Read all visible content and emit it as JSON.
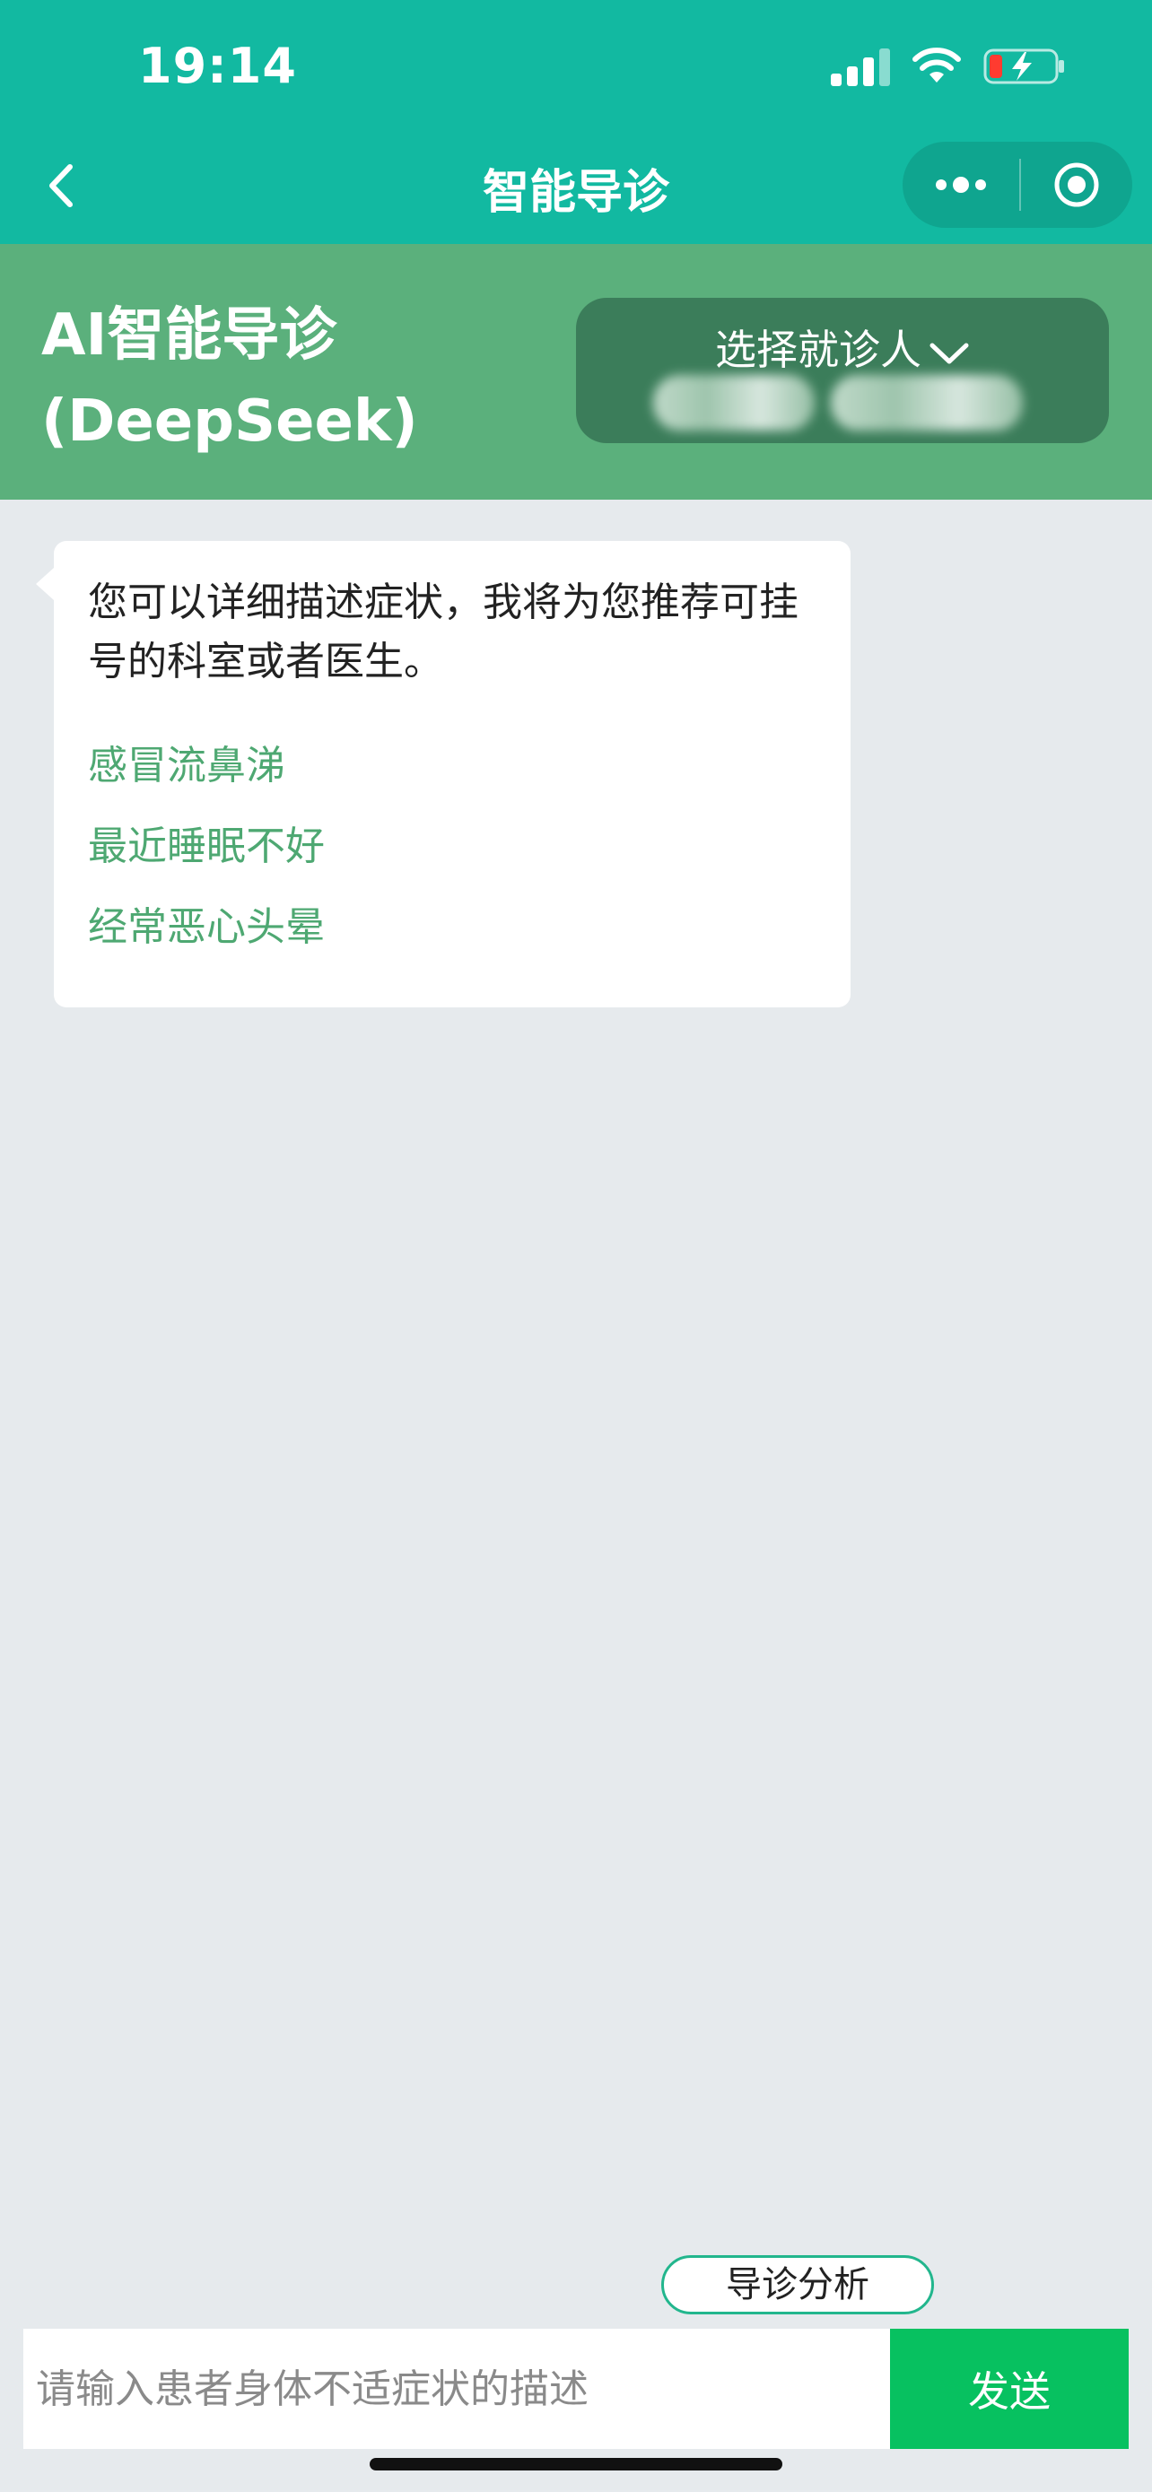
{
  "status_bar": {
    "time": "19:14"
  },
  "nav": {
    "title": "智能导诊"
  },
  "hero": {
    "title_line1": "AI智能导诊",
    "title_line2": "(DeepSeek)",
    "patient_select_label": "选择就诊人"
  },
  "chat": {
    "message": "您可以详细描述症状，我将为您推荐可挂号的科室或者医生。",
    "suggestions": [
      "感冒流鼻涕",
      "最近睡眠不好",
      "经常恶心头晕"
    ]
  },
  "bottom": {
    "analysis_label": "导诊分析",
    "input_placeholder": "请输入患者身体不适症状的描述",
    "send_label": "发送"
  },
  "colors": {
    "nav_bg": "#12b9a1",
    "hero_bg": "#5bb07c",
    "suggestion_text": "#4ea872",
    "send_bg": "#07c160"
  }
}
